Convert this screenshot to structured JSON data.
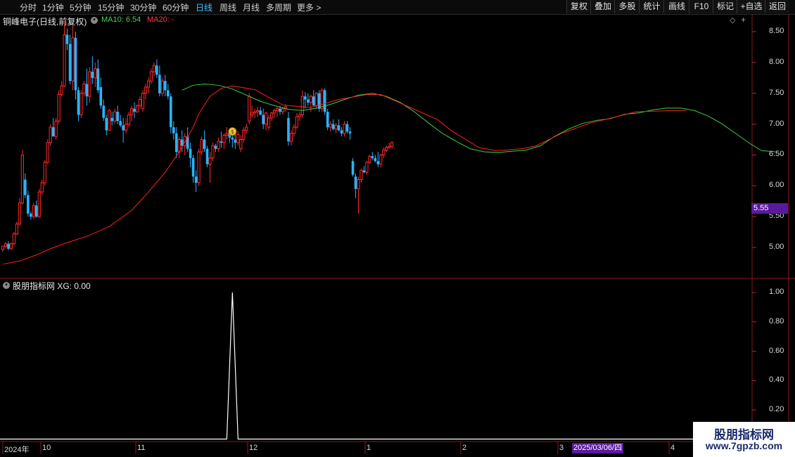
{
  "toolbar": {
    "timeframes": [
      "分时",
      "1分钟",
      "5分钟",
      "15分钟",
      "30分钟",
      "60分钟",
      "日线",
      "周线",
      "月线",
      "多周期",
      "更多 >"
    ],
    "active": "日线",
    "buttons": [
      "复权",
      "叠加",
      "多股",
      "统计",
      "画线",
      "F10",
      "标记",
      "+自选",
      "返回"
    ]
  },
  "chart_header": {
    "stock_title": "铜峰电子(日线,前复权)",
    "ma10_label": "MA10: 6.54",
    "ma20_label": "MA20: -"
  },
  "indicator_header": {
    "title": "股朋指标网 XG: 0.00"
  },
  "price_axis": [
    "8.50",
    "8.00",
    "7.50",
    "7.00",
    "6.50",
    "6.00",
    "5.50",
    "5.00"
  ],
  "indicator_axis": [
    "1.00",
    "0.80",
    "0.60",
    "0.40",
    "0.20"
  ],
  "current_price": "5.55",
  "x_axis_labels": [
    "2024年",
    "10",
    "11",
    "12",
    "1",
    "2",
    "3",
    "4"
  ],
  "highlight_date": "2025/03/06/四",
  "watermark": {
    "line1": "股朋指标网",
    "line2": "www.7gpzb.com"
  },
  "colors": {
    "up": "#ff2a2a",
    "down": "#2ab4ff",
    "ma10": "#3cd03c",
    "ma20": "#ff2020",
    "indicator": "#ffffff",
    "highlight": "#5a1a9e"
  },
  "chart_data": {
    "type": "candlestick",
    "ylim": [
      4.7,
      8.7
    ],
    "ohlc": [
      [
        4.97,
        5.03,
        4.93,
        5.02
      ],
      [
        5.02,
        5.09,
        4.99,
        5.06
      ],
      [
        5.06,
        5.1,
        4.95,
        4.98
      ],
      [
        4.98,
        5.08,
        4.96,
        5.06
      ],
      [
        5.06,
        5.25,
        5.04,
        5.22
      ],
      [
        5.22,
        5.42,
        5.2,
        5.38
      ],
      [
        5.38,
        5.8,
        5.35,
        5.72
      ],
      [
        5.72,
        6.58,
        5.7,
        6.5
      ],
      [
        6.1,
        6.2,
        5.8,
        5.85
      ],
      [
        5.85,
        5.92,
        5.5,
        5.55
      ],
      [
        5.55,
        5.58,
        5.45,
        5.5
      ],
      [
        5.5,
        5.72,
        5.46,
        5.68
      ],
      [
        5.68,
        5.76,
        5.48,
        5.5
      ],
      [
        5.5,
        5.95,
        5.48,
        5.9
      ],
      [
        5.9,
        6.1,
        5.85,
        6.05
      ],
      [
        6.05,
        6.42,
        6.0,
        6.38
      ],
      [
        6.38,
        6.75,
        6.35,
        6.7
      ],
      [
        6.7,
        7.0,
        6.65,
        6.95
      ],
      [
        6.95,
        7.1,
        6.85,
        6.8
      ],
      [
        6.8,
        7.1,
        6.75,
        7.05
      ],
      [
        7.05,
        7.55,
        7.0,
        7.48
      ],
      [
        7.48,
        7.7,
        7.45,
        7.62
      ],
      [
        7.62,
        8.65,
        7.6,
        8.45
      ],
      [
        8.45,
        8.55,
        8.2,
        8.3
      ],
      [
        8.3,
        8.45,
        7.65,
        7.7
      ],
      [
        7.7,
        8.6,
        7.55,
        8.4
      ],
      [
        8.4,
        8.5,
        7.4,
        7.55
      ],
      [
        7.55,
        7.6,
        7.05,
        7.15
      ],
      [
        7.15,
        7.55,
        7.1,
        7.5
      ],
      [
        7.5,
        7.7,
        7.45,
        7.65
      ],
      [
        7.65,
        7.9,
        7.3,
        7.45
      ],
      [
        7.45,
        7.92,
        7.35,
        7.85
      ],
      [
        7.85,
        8.1,
        7.65,
        7.75
      ],
      [
        7.75,
        8.0,
        7.6,
        7.9
      ],
      [
        7.9,
        8.05,
        7.5,
        7.55
      ],
      [
        7.6,
        7.75,
        7.25,
        7.3
      ],
      [
        7.3,
        7.4,
        7.05,
        7.1
      ],
      [
        7.1,
        7.15,
        6.82,
        6.9
      ],
      [
        6.9,
        7.25,
        6.9,
        7.22
      ],
      [
        7.1,
        7.2,
        6.98,
        7.05
      ],
      [
        7.05,
        7.25,
        7.0,
        7.2
      ],
      [
        7.2,
        7.3,
        7.0,
        7.05
      ],
      [
        7.05,
        7.15,
        6.95,
        6.98
      ],
      [
        6.98,
        7.1,
        6.7,
        6.9
      ],
      [
        6.9,
        7.1,
        6.85,
        7.0
      ],
      [
        7.0,
        7.2,
        6.95,
        7.15
      ],
      [
        7.15,
        7.3,
        7.05,
        7.25
      ],
      [
        7.25,
        7.35,
        7.1,
        7.2
      ],
      [
        7.2,
        7.32,
        7.18,
        7.3
      ],
      [
        7.3,
        7.45,
        7.25,
        7.4
      ],
      [
        7.25,
        7.55,
        7.2,
        7.5
      ],
      [
        7.5,
        7.65,
        7.4,
        7.6
      ],
      [
        7.6,
        7.75,
        7.5,
        7.7
      ],
      [
        7.7,
        7.9,
        7.65,
        7.85
      ],
      [
        7.85,
        8.0,
        7.78,
        7.95
      ],
      [
        7.95,
        8.05,
        7.75,
        7.8
      ],
      [
        7.8,
        7.95,
        7.45,
        7.5
      ],
      [
        7.5,
        7.75,
        7.45,
        7.7
      ],
      [
        7.7,
        7.8,
        7.45,
        7.55
      ],
      [
        7.55,
        7.65,
        7.4,
        7.45
      ],
      [
        7.45,
        7.5,
        6.85,
        6.95
      ],
      [
        6.95,
        7.05,
        6.75,
        6.85
      ],
      [
        6.85,
        6.95,
        6.45,
        6.55
      ],
      [
        6.55,
        6.8,
        6.45,
        6.75
      ],
      [
        6.75,
        6.9,
        6.55,
        6.65
      ],
      [
        6.65,
        6.85,
        6.5,
        6.8
      ],
      [
        6.8,
        6.95,
        6.55,
        6.6
      ],
      [
        6.6,
        6.7,
        6.3,
        6.45
      ],
      [
        6.45,
        6.5,
        6.05,
        6.15
      ],
      [
        6.15,
        6.25,
        5.9,
        6.05
      ],
      [
        6.05,
        6.6,
        6.0,
        6.55
      ],
      [
        6.55,
        6.8,
        6.5,
        6.75
      ],
      [
        6.75,
        6.9,
        6.55,
        6.6
      ],
      [
        6.6,
        6.65,
        6.3,
        6.35
      ],
      [
        6.35,
        6.55,
        6.05,
        6.45
      ],
      [
        6.45,
        6.7,
        6.4,
        6.65
      ],
      [
        6.65,
        6.68,
        6.55,
        6.6
      ],
      [
        6.6,
        6.78,
        6.55,
        6.72
      ],
      [
        6.72,
        6.88,
        6.62,
        6.7
      ],
      [
        6.7,
        6.85,
        6.6,
        6.82
      ],
      [
        6.82,
        6.95,
        6.75,
        6.85
      ],
      [
        6.85,
        6.92,
        6.7,
        6.78
      ],
      [
        6.78,
        6.82,
        6.62,
        6.75
      ],
      [
        6.75,
        6.85,
        6.6,
        6.7
      ],
      [
        6.7,
        6.88,
        6.65,
        6.83
      ],
      [
        6.6,
        6.82,
        6.55,
        6.75
      ],
      [
        6.75,
        6.95,
        6.7,
        6.9
      ],
      [
        6.9,
        7.0,
        6.85,
        6.95
      ],
      [
        7.05,
        7.5,
        7.0,
        7.45
      ],
      [
        7.15,
        7.3,
        7.1,
        7.18
      ],
      [
        7.18,
        7.25,
        7.1,
        7.2
      ],
      [
        7.2,
        7.28,
        7.12,
        7.22
      ],
      [
        7.22,
        7.28,
        7.15,
        7.15
      ],
      [
        7.15,
        7.25,
        6.92,
        7.0
      ],
      [
        7.0,
        7.2,
        6.9,
        7.18
      ],
      [
        6.95,
        7.15,
        6.9,
        7.1
      ],
      [
        7.1,
        7.2,
        7.05,
        7.18
      ],
      [
        7.18,
        7.25,
        7.1,
        7.22
      ],
      [
        7.22,
        7.28,
        7.12,
        7.25
      ],
      [
        7.25,
        7.3,
        7.15,
        7.2
      ],
      [
        7.2,
        7.28,
        7.15,
        7.25
      ],
      [
        7.25,
        7.32,
        7.2,
        7.28
      ],
      [
        7.1,
        7.2,
        6.65,
        6.72
      ],
      [
        6.72,
        6.9,
        6.65,
        6.85
      ],
      [
        6.85,
        7.0,
        6.8,
        6.95
      ],
      [
        6.95,
        7.18,
        6.92,
        7.12
      ],
      [
        7.12,
        7.2,
        7.05,
        7.15
      ],
      [
        7.15,
        7.55,
        7.1,
        7.45
      ],
      [
        7.45,
        7.52,
        7.25,
        7.4
      ],
      [
        7.4,
        7.5,
        7.3,
        7.35
      ],
      [
        7.35,
        7.48,
        7.2,
        7.45
      ],
      [
        7.45,
        7.55,
        7.3,
        7.3
      ],
      [
        7.3,
        7.52,
        7.25,
        7.5
      ],
      [
        7.5,
        7.55,
        7.2,
        7.25
      ],
      [
        7.25,
        7.58,
        7.2,
        7.55
      ],
      [
        7.55,
        7.58,
        7.15,
        7.2
      ],
      [
        7.2,
        7.25,
        6.9,
        6.95
      ],
      [
        6.95,
        7.05,
        6.88,
        7.0
      ],
      [
        7.0,
        7.08,
        6.9,
        6.92
      ],
      [
        6.92,
        7.02,
        6.85,
        6.98
      ],
      [
        6.98,
        7.08,
        6.88,
        6.9
      ],
      [
        6.9,
        6.95,
        6.8,
        6.85
      ],
      [
        6.85,
        7.05,
        6.8,
        7.0
      ],
      [
        7.0,
        7.05,
        6.85,
        6.88
      ],
      [
        6.88,
        6.95,
        6.75,
        6.85
      ],
      [
        6.4,
        6.45,
        6.15,
        6.18
      ],
      [
        6.15,
        6.2,
        5.8,
        5.95
      ],
      [
        5.95,
        6.15,
        5.55,
        6.1
      ],
      [
        6.1,
        6.28,
        6.05,
        6.25
      ],
      [
        6.25,
        6.32,
        6.2,
        6.22
      ],
      [
        6.22,
        6.4,
        6.18,
        6.38
      ],
      [
        6.38,
        6.5,
        6.35,
        6.48
      ],
      [
        6.48,
        6.55,
        6.42,
        6.45
      ],
      [
        6.45,
        6.5,
        6.38,
        6.4
      ],
      [
        6.4,
        6.55,
        6.3,
        6.35
      ],
      [
        6.35,
        6.52,
        6.3,
        6.5
      ],
      [
        6.5,
        6.62,
        6.45,
        6.58
      ],
      [
        6.58,
        6.65,
        6.55,
        6.62
      ],
      [
        6.62,
        6.7,
        6.6,
        6.64
      ],
      [
        6.64,
        6.72,
        6.6,
        6.7
      ]
    ],
    "ma10": [
      [
        64,
        7.55
      ],
      [
        68,
        7.63
      ],
      [
        72,
        7.65
      ],
      [
        77,
        7.63
      ],
      [
        82,
        7.57
      ],
      [
        87,
        7.47
      ],
      [
        92,
        7.37
      ],
      [
        97,
        7.3
      ],
      [
        102,
        7.24
      ],
      [
        107,
        7.22
      ],
      [
        112,
        7.26
      ],
      [
        117,
        7.32
      ],
      [
        122,
        7.4
      ],
      [
        127,
        7.47
      ],
      [
        132,
        7.5
      ],
      [
        137,
        7.45
      ],
      [
        142,
        7.35
      ],
      [
        147,
        7.2
      ],
      [
        152,
        7.02
      ],
      [
        157,
        6.85
      ],
      [
        162,
        6.72
      ],
      [
        167,
        6.6
      ],
      [
        172,
        6.55
      ],
      [
        177,
        6.54
      ],
      [
        182,
        6.56
      ],
      [
        187,
        6.58
      ],
      [
        192,
        6.65
      ],
      [
        197,
        6.8
      ],
      [
        202,
        6.92
      ],
      [
        207,
        7.01
      ],
      [
        212,
        7.06
      ],
      [
        217,
        7.09
      ],
      [
        222,
        7.16
      ],
      [
        227,
        7.18
      ],
      [
        232,
        7.23
      ],
      [
        237,
        7.26
      ],
      [
        242,
        7.26
      ],
      [
        247,
        7.22
      ],
      [
        252,
        7.13
      ],
      [
        257,
        7.0
      ],
      [
        262,
        6.84
      ],
      [
        267,
        6.68
      ],
      [
        271,
        6.57
      ],
      [
        276,
        6.55
      ]
    ],
    "ma20": [
      [
        0,
        4.73
      ],
      [
        6,
        4.78
      ],
      [
        12,
        4.88
      ],
      [
        17,
        4.98
      ],
      [
        23,
        5.08
      ],
      [
        30,
        5.18
      ],
      [
        38,
        5.34
      ],
      [
        46,
        5.6
      ],
      [
        52,
        5.9
      ],
      [
        58,
        6.22
      ],
      [
        63,
        6.55
      ],
      [
        68,
        6.95
      ],
      [
        70,
        7.17
      ],
      [
        74,
        7.45
      ],
      [
        78,
        7.58
      ],
      [
        82,
        7.62
      ],
      [
        90,
        7.56
      ],
      [
        100,
        7.31
      ],
      [
        110,
        7.27
      ],
      [
        120,
        7.4
      ],
      [
        130,
        7.48
      ],
      [
        135,
        7.48
      ],
      [
        145,
        7.28
      ],
      [
        155,
        7.08
      ],
      [
        160,
        6.9
      ],
      [
        170,
        6.62
      ],
      [
        176,
        6.57
      ],
      [
        180,
        6.58
      ],
      [
        185,
        6.6
      ],
      [
        190,
        6.64
      ],
      [
        200,
        6.86
      ],
      [
        210,
        7.02
      ],
      [
        220,
        7.13
      ],
      [
        226,
        7.2
      ],
      [
        240,
        7.22
      ],
      [
        244,
        7.22
      ]
    ],
    "xg": {
      "ylim": [
        0,
        1.0
      ],
      "spike_index": 82,
      "spike_value": 1.0,
      "total": 277
    },
    "marker_index": 82
  }
}
